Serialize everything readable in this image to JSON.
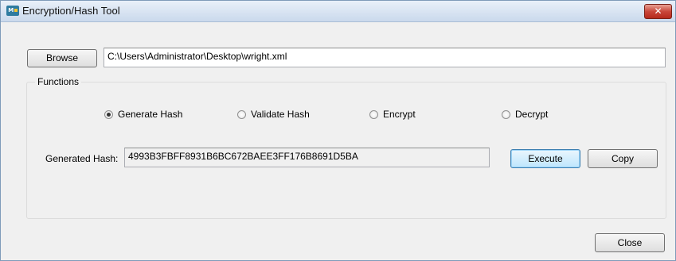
{
  "window": {
    "title": "Encryption/Hash Tool",
    "app_icon_text": "M",
    "close_glyph": "✕"
  },
  "file": {
    "browse_label": "Browse",
    "path_value": "C:\\Users\\Administrator\\Desktop\\wright.xml"
  },
  "functions": {
    "group_label": "Functions",
    "options": [
      {
        "label": "Generate Hash",
        "selected": true
      },
      {
        "label": "Validate Hash",
        "selected": false
      },
      {
        "label": "Encrypt",
        "selected": false
      },
      {
        "label": "Decrypt",
        "selected": false
      }
    ],
    "hash_label": "Generated Hash:",
    "hash_value": "4993B3FBFF8931B6BC672BAEE3FF176B8691D5BA",
    "execute_label": "Execute",
    "copy_label": "Copy"
  },
  "footer": {
    "close_label": "Close"
  },
  "icons": {
    "app": "app-logo-icon",
    "close": "close-icon",
    "radio": "radio-button-icon"
  },
  "colors": {
    "title_gradient_top": "#e9f0f9",
    "close_button": "#c9463a",
    "default_button_border": "#3c7fb1"
  }
}
